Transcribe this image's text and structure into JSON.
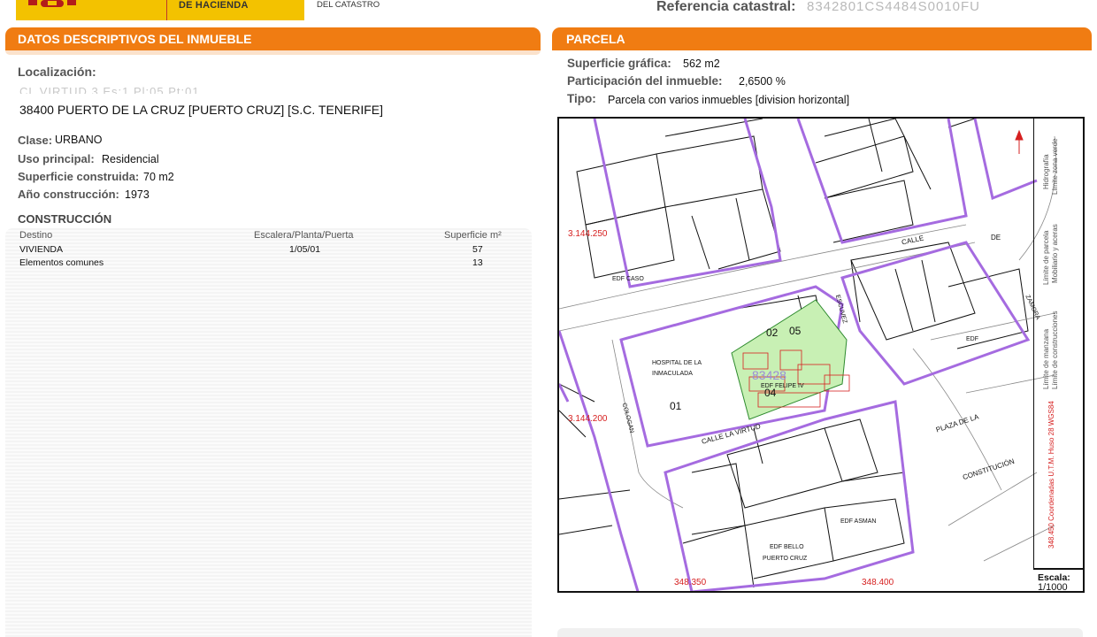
{
  "header": {
    "ministry_line": "DE HACIENDA",
    "direction_line": "DEL CATASTRO",
    "ref_label": "Referencia catastral:",
    "ref_value": "8342801CS4484S0010FU"
  },
  "left": {
    "section_title": "DATOS DESCRIPTIVOS DEL INMUEBLE",
    "localizacion_label": "Localización:",
    "address_line1": "CL VIRTUD 3 Es:1 Pl:05 Pt:01",
    "address_line2": "38400 PUERTO DE LA CRUZ [PUERTO CRUZ] [S.C. TENERIFE]",
    "clase_label": "Clase:",
    "clase_value": "URBANO",
    "uso_label": "Uso principal:",
    "uso_value": "Residencial",
    "sup_label": "Superficie construida:",
    "sup_value": "70 m2",
    "anio_label": "Año construcción:",
    "anio_value": "1973",
    "construccion_title": "CONSTRUCCIÓN",
    "table": {
      "headers": [
        "Destino",
        "Escalera/Planta/Puerta",
        "Superficie m²"
      ],
      "rows": [
        [
          "VIVIENDA",
          "1/05/01",
          "57"
        ],
        [
          "Elementos comunes",
          "",
          "13"
        ]
      ]
    }
  },
  "right": {
    "section_title": "PARCELA",
    "sup_grafica_label": "Superficie gráfica:",
    "sup_grafica_value": "562 m2",
    "participacion_label": "Participación del inmueble:",
    "participacion_value": "2,6500 %",
    "tipo_label": "Tipo:",
    "tipo_value": "Parcela con varios inmuebles [division horizontal]",
    "map": {
      "coord_y1": "3.144.250",
      "coord_y2": "3.144.200",
      "coord_x1": "348.350",
      "coord_x2": "348.400",
      "parcel_ref": "83428",
      "labels": {
        "hospital": "HOSPITAL DE LA",
        "hospital2": "INMACULADA",
        "edf_felipe": "EDF FELIPE IV",
        "edf_caso": "EDF CASO",
        "edf": "EDF",
        "edf_asman": "EDF ASMAN",
        "edf_bello": "EDF BELLO",
        "puerto_cruz": "PUERTO CRUZ",
        "calle_virtud": "CALLE LA VIRTUD",
        "plaza": "PLAZA DE LA",
        "constitucion": "CONSTITUCIÓN",
        "calle": "CALLE",
        "de": "DE",
        "zamora": "ZAMORA",
        "escuvez": "ESCUVEZ",
        "cologan": "COLOGAN",
        "n01": "01",
        "n02": "02",
        "n04": "04",
        "n05": "05"
      },
      "legend": {
        "l1": "Límite de manzana",
        "l2": "Límite de parcela",
        "l3": "Hidrografía",
        "l4": "Límite de construcciones",
        "l5": "Mobiliario y aceras",
        "l6": "Límite zona verde",
        "coords_note": "348.450 Coordenadas U.T.M. Huso 28 WGS84"
      },
      "scale_label": "Escala:",
      "scale_value": "1/1000"
    }
  },
  "colors": {
    "accent_orange": "#f07c12",
    "header_yellow": "#f3c200",
    "parcel_violet": "#a56be0",
    "parcel_green": "#c8f0b4",
    "coord_red": "#d62020",
    "label_blue": "#2a2ad0"
  }
}
